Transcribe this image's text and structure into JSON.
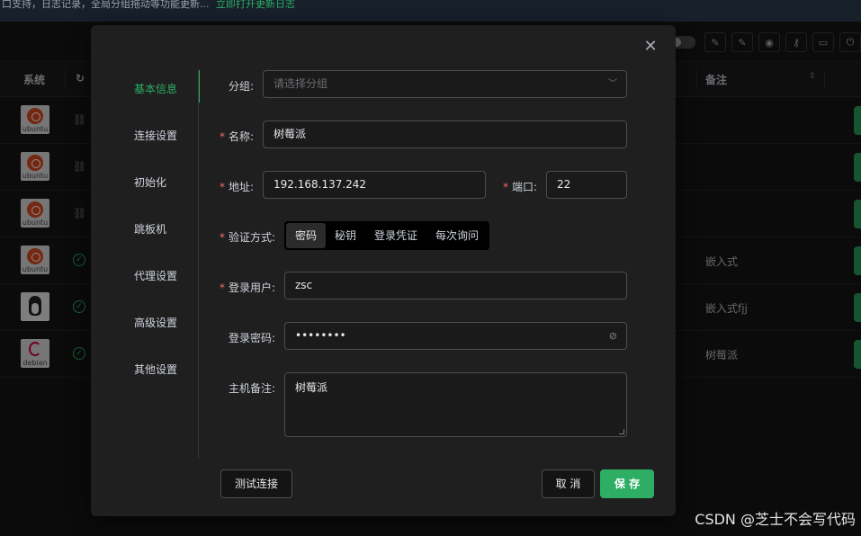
{
  "background": {
    "banner_text": "口支持，日志记录，全局分组拖动等功能更新...",
    "banner_link": "立即打开更新日志",
    "table_headers": {
      "system": "系统",
      "status_partial": "↻",
      "notes": "备注"
    },
    "rows": [
      {
        "os": "ubuntu",
        "status": "link",
        "note": ""
      },
      {
        "os": "ubuntu",
        "status": "link",
        "note": ""
      },
      {
        "os": "ubuntu",
        "status": "link",
        "note": ""
      },
      {
        "os": "ubuntu",
        "status": "ok",
        "note": "嵌入式"
      },
      {
        "os": "linux",
        "status": "ok",
        "note": "嵌入式fjj"
      },
      {
        "os": "debian",
        "status": "ok",
        "note": "树莓派"
      }
    ],
    "logo_labels": {
      "ubuntu": "ubuntu",
      "debian": "debian"
    },
    "toolbar_icons": [
      "edit-icon",
      "edit-alt-icon",
      "eye-icon",
      "key-icon",
      "terminal-icon",
      "power-icon"
    ]
  },
  "dialog": {
    "close_glyph": "✕",
    "nav": [
      "基本信息",
      "连接设置",
      "初始化",
      "跳板机",
      "代理设置",
      "高级设置",
      "其他设置"
    ],
    "active_nav_index": 0,
    "form": {
      "group_label": "分组:",
      "group_placeholder": "请选择分组",
      "name_label": "名称:",
      "name_value": "树莓派",
      "address_label": "地址:",
      "address_value": "192.168.137.242",
      "port_label": "端口:",
      "port_value": "22",
      "auth_label": "验证方式:",
      "auth_options": [
        "密码",
        "秘钥",
        "登录凭证",
        "每次询问"
      ],
      "auth_selected": "密码",
      "user_label": "登录用户:",
      "user_value": "zsc",
      "password_label": "登录密码:",
      "password_value": "••••••••",
      "remark_label": "主机备注:",
      "remark_value": "树莓派"
    },
    "buttons": {
      "test": "测试连接",
      "cancel": "取 消",
      "save": "保 存"
    }
  },
  "colors": {
    "accent": "#2eae64",
    "required": "#f56c6c",
    "dialog_bg": "#1f1f1f"
  },
  "watermark": "CSDN @芝士不会写代码"
}
